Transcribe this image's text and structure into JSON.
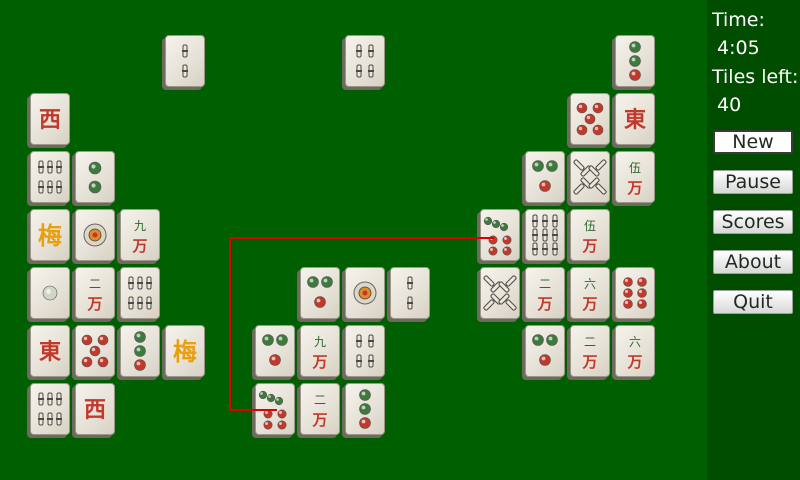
{
  "sidebar": {
    "time_label": "Time:",
    "time_value": "4:05",
    "tiles_left_label": "Tiles left:",
    "tiles_left_value": "40",
    "buttons": [
      {
        "label": "New",
        "active": true
      },
      {
        "label": "Pause",
        "active": false
      },
      {
        "label": "Scores",
        "active": false
      },
      {
        "label": "About",
        "active": false
      },
      {
        "label": "Quit",
        "active": false
      }
    ]
  },
  "colors": {
    "felt": "#005f00",
    "panel": "#004d00",
    "tile_face": "#f0ece3",
    "red": "#c0392b",
    "green": "#3e7a3e",
    "path": "#dd0000"
  },
  "board": {
    "tiles": [
      {
        "kind": "bamboo2",
        "label": "2 bamboo"
      },
      {
        "kind": "bamboo4",
        "label": "4 bamboo"
      },
      {
        "kind": "circle4",
        "label": "4 circles"
      },
      {
        "kind": "char",
        "ch": "西",
        "label": "west wind"
      },
      {
        "kind": "circle5",
        "label": "5 circles"
      },
      {
        "kind": "char",
        "ch": "東",
        "label": "east wind"
      },
      {
        "kind": "bamboo6",
        "label": "6 bamboo"
      },
      {
        "kind": "circle2",
        "label": "2 circles"
      },
      {
        "kind": "circle3",
        "label": "3 circles"
      },
      {
        "kind": "bamboo8",
        "label": "8 bamboo"
      },
      {
        "kind": "num",
        "top": "伍",
        "bottom": "万",
        "label": "5 characters"
      },
      {
        "kind": "flower",
        "ch": "梅",
        "label": "plum flower"
      },
      {
        "kind": "circle1",
        "label": "1 circle"
      },
      {
        "kind": "num",
        "top": "九",
        "bottom": "万",
        "label": "9 characters"
      },
      {
        "kind": "circle7",
        "label": "7 circles"
      },
      {
        "kind": "bamboo9",
        "label": "9 bamboo"
      },
      {
        "kind": "num",
        "top": "伍",
        "bottom": "万",
        "label": "5 characters"
      },
      {
        "kind": "circle1g",
        "label": "1 circle"
      },
      {
        "kind": "num",
        "top": "二",
        "bottom": "万",
        "label": "2 characters"
      },
      {
        "kind": "bamboo6",
        "label": "6 bamboo"
      },
      {
        "kind": "circle3",
        "label": "3 circles"
      },
      {
        "kind": "circle1",
        "label": "1 circle"
      },
      {
        "kind": "bamboo2",
        "label": "2 bamboo"
      },
      {
        "kind": "bamboo8",
        "label": "8 bamboo"
      },
      {
        "kind": "num",
        "top": "二",
        "bottom": "万",
        "label": "2 characters"
      },
      {
        "kind": "num",
        "top": "六",
        "bottom": "万",
        "label": "6 characters"
      },
      {
        "kind": "circle6",
        "label": "6 circles"
      },
      {
        "kind": "char",
        "ch": "東",
        "label": "east wind"
      },
      {
        "kind": "circle5",
        "label": "5 circles"
      },
      {
        "kind": "circle4",
        "label": "4 circles"
      },
      {
        "kind": "flower",
        "ch": "梅",
        "label": "plum flower"
      },
      {
        "kind": "circle3",
        "label": "3 circles"
      },
      {
        "kind": "num",
        "top": "九",
        "bottom": "万",
        "label": "9 characters"
      },
      {
        "kind": "bamboo4",
        "label": "4 bamboo"
      },
      {
        "kind": "circle3",
        "label": "3 circles"
      },
      {
        "kind": "num",
        "top": "二",
        "bottom": "万",
        "label": "2 characters"
      },
      {
        "kind": "num",
        "top": "六",
        "bottom": "万",
        "label": "6 characters"
      },
      {
        "kind": "bamboo6",
        "label": "6 bamboo"
      },
      {
        "kind": "char",
        "ch": "西",
        "label": "west wind"
      },
      {
        "kind": "circle7",
        "label": "7 circles"
      },
      {
        "kind": "num",
        "top": "二",
        "bottom": "万",
        "label": "2 characters"
      },
      {
        "kind": "circle4",
        "label": "4 circles"
      }
    ]
  }
}
